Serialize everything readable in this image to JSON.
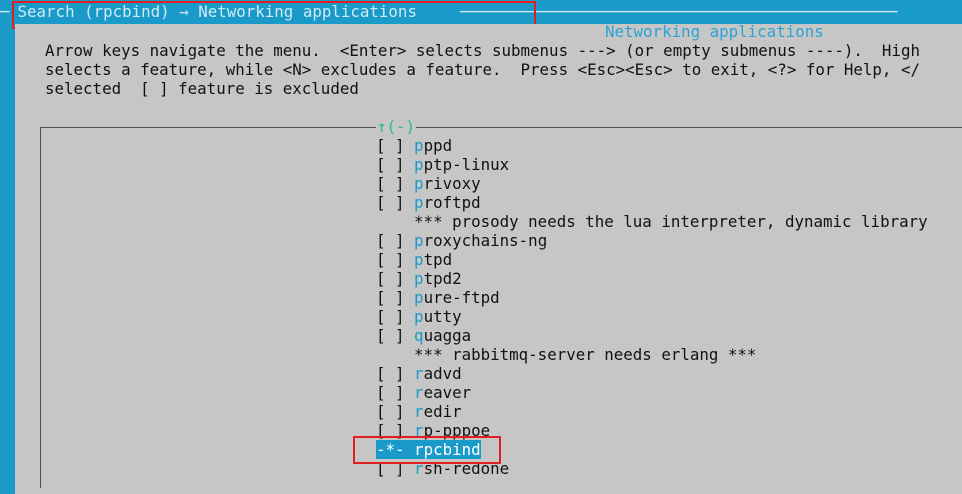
{
  "topbar": {
    "left_dashes": "─",
    "title": " Search (rpcbind) → Networking applications ",
    "trailing": "──────────────────────────────────────────────"
  },
  "dialog": {
    "title": "Networking applications",
    "help_lines": [
      "Arrow keys navigate the menu.  <Enter> selects submenus ---> (or empty submenus ----).  High",
      "selects a feature, while <N> excludes a feature.  Press <Esc><Esc> to exit, <?> for Help, </",
      "selected  [ ] feature is excluded"
    ],
    "scroll_indicator": "↑(-)"
  },
  "menu_items": [
    {
      "mark": "[ ] ",
      "hot": "p",
      "rest": "ppd",
      "type": "option"
    },
    {
      "mark": "[ ] ",
      "hot": "p",
      "rest": "ptp-linux",
      "type": "option"
    },
    {
      "mark": "[ ] ",
      "hot": "p",
      "rest": "rivoxy",
      "type": "option"
    },
    {
      "mark": "[ ] ",
      "hot": "p",
      "rest": "roftpd",
      "type": "option"
    },
    {
      "mark": "    ",
      "hot": "",
      "rest": "*** prosody needs the lua interpreter, dynamic library",
      "type": "comment"
    },
    {
      "mark": "[ ] ",
      "hot": "p",
      "rest": "roxychains-ng",
      "type": "option"
    },
    {
      "mark": "[ ] ",
      "hot": "p",
      "rest": "tpd",
      "type": "option"
    },
    {
      "mark": "[ ] ",
      "hot": "p",
      "rest": "tpd2",
      "type": "option"
    },
    {
      "mark": "[ ] ",
      "hot": "p",
      "rest": "ure-ftpd",
      "type": "option"
    },
    {
      "mark": "[ ] ",
      "hot": "p",
      "rest": "utty",
      "type": "option"
    },
    {
      "mark": "[ ] ",
      "hot": "q",
      "rest": "uagga",
      "type": "option"
    },
    {
      "mark": "    ",
      "hot": "",
      "rest": "*** rabbitmq-server needs erlang ***",
      "type": "comment"
    },
    {
      "mark": "[ ] ",
      "hot": "r",
      "rest": "advd",
      "type": "option"
    },
    {
      "mark": "[ ] ",
      "hot": "r",
      "rest": "eaver",
      "type": "option"
    },
    {
      "mark": "[ ] ",
      "hot": "r",
      "rest": "edir",
      "type": "option"
    },
    {
      "mark": "[ ] ",
      "hot": "r",
      "rest": "p-pppoe",
      "type": "option"
    },
    {
      "mark": "-*- ",
      "hot": "r",
      "rest": "pcbind",
      "type": "selected"
    },
    {
      "mark": "[ ] ",
      "hot": "r",
      "rest": "sh-redone",
      "type": "option"
    }
  ],
  "colors": {
    "background": "#1a9ac8",
    "dialog": "#c6c6c6",
    "highlight": "#1a9ac8",
    "annotation_box": "#e02020"
  }
}
